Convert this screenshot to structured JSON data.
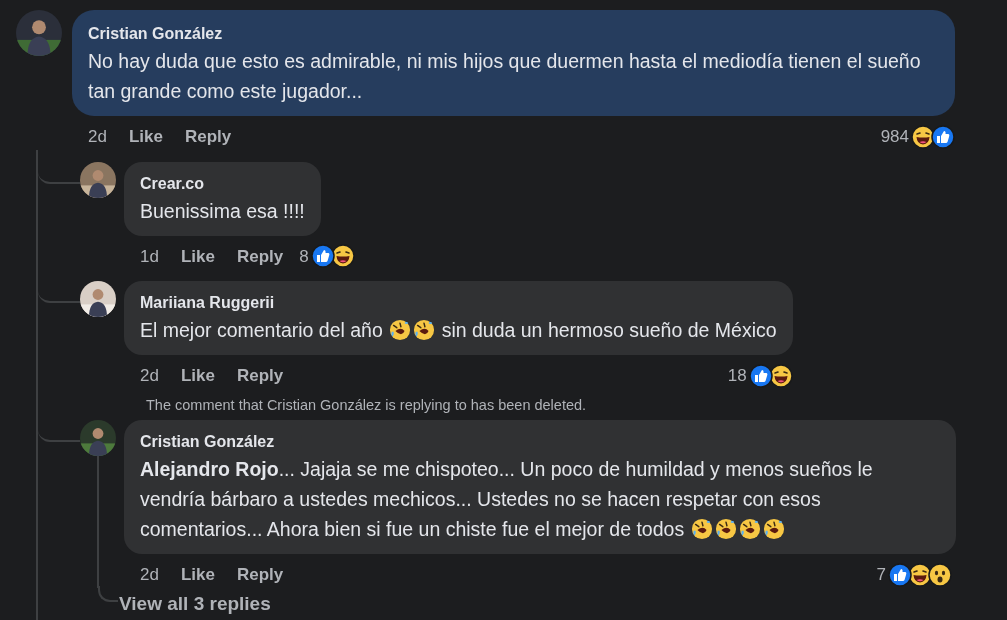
{
  "comment": {
    "author": "Cristian González",
    "parts": [
      {
        "kind": "text",
        "text": "No hay duda que esto es admirable, ni mis hijos que duermen hasta el mediodía tienen el sueño tan grande como este jugador..."
      }
    ],
    "time": "2d",
    "like": "Like",
    "reply": "Reply",
    "reaction_count": "984",
    "reactions": [
      {
        "kind": "haha"
      },
      {
        "kind": "like"
      }
    ]
  },
  "replies": [
    {
      "author": "Crear.co",
      "parts": [
        {
          "kind": "text",
          "text": "Buenissima esa !!!!"
        }
      ],
      "time": "1d",
      "like": "Like",
      "reply": "Reply",
      "reaction_count": "8",
      "reactions": [
        {
          "kind": "like"
        },
        {
          "kind": "haha"
        }
      ]
    },
    {
      "author": "Mariiana Ruggerii",
      "parts": [
        {
          "kind": "text",
          "text": "El mejor comentario del año "
        },
        {
          "kind": "emoji"
        },
        {
          "kind": "emoji"
        },
        {
          "kind": "text",
          "text": " sin duda un hermoso sueño de México"
        }
      ],
      "time": "2d",
      "like": "Like",
      "reply": "Reply",
      "reaction_count": "18",
      "reactions": [
        {
          "kind": "like"
        },
        {
          "kind": "haha"
        }
      ]
    },
    {
      "notice": "The comment that Cristian González is replying to has been deleted.",
      "author": "Cristian González",
      "parts": [
        {
          "kind": "text",
          "text": "**Alejandro Rojo**... Jajaja se me chispoteo... Un poco de humildad y menos sueños le vendría bárbaro a ustedes mechicos... Ustedes no se hacen respetar con esos comentarios... Ahora bien si fue un chiste fue el mejor de todos "
        },
        {
          "kind": "emoji"
        },
        {
          "kind": "emoji"
        },
        {
          "kind": "emoji"
        },
        {
          "kind": "emoji"
        }
      ],
      "time": "2d",
      "like": "Like",
      "reply": "Reply",
      "reaction_count": "7",
      "reactions": [
        {
          "kind": "like"
        },
        {
          "kind": "haha"
        },
        {
          "kind": "wow"
        }
      ],
      "more_replies": "View all 3 replies"
    }
  ]
}
